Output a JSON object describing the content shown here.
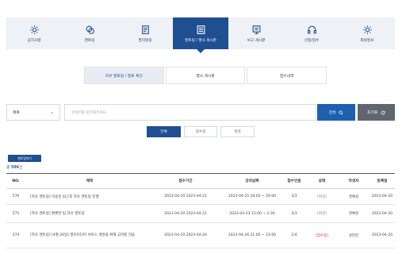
{
  "topnav": {
    "items": [
      {
        "label": "공지사항",
        "icon": "gear-icon",
        "active": false
      },
      {
        "label": "멘토링",
        "icon": "chat-icon",
        "active": false
      },
      {
        "label": "필리밍링",
        "icon": "document-icon",
        "active": false
      },
      {
        "label": "멘토링 / 행사 게시판",
        "icon": "board-icon",
        "active": true
      },
      {
        "label": "보고 게시판",
        "icon": "report-icon",
        "active": false
      },
      {
        "label": "신청/접수",
        "icon": "headset-icon",
        "active": false
      },
      {
        "label": "회원정보",
        "icon": "gear-icon",
        "active": false
      }
    ],
    "active_color": "#1e4f90"
  },
  "subtabs": [
    {
      "label": "자유 멘토링 / 멘토 특강",
      "active": true
    },
    {
      "label": "행사 게시판",
      "active": false
    },
    {
      "label": "접수내역",
      "active": false
    }
  ],
  "search": {
    "select_value": "제목",
    "placeholder": "검색어를 입력해주세요.",
    "search_label": "검색",
    "reset_label": "초기화"
  },
  "filters": [
    {
      "label": "전체",
      "active": true
    },
    {
      "label": "접수중",
      "active": false
    },
    {
      "label": "마감",
      "active": false
    }
  ],
  "list": {
    "open_button": "멘토링하기",
    "total_prefix": "총",
    "total_count": "596",
    "total_suffix": "건"
  },
  "table": {
    "headers": [
      "NO.",
      "제목",
      "접수기간",
      "강의날짜",
      "접수인원",
      "상태",
      "작성자",
      "등록일"
    ],
    "rows": [
      {
        "no": "576",
        "title": "[자유 멘토링] 이승민 퇴근후 자유 멘토링 진행",
        "period": "2023-04-20 2023-04-21",
        "date": "2023-04-25 18:00 ~ 20:00",
        "count": "3/3",
        "status": "[마감]",
        "status_type": "closed",
        "author": "권예성",
        "reg": "2023-04-20"
      },
      {
        "no": "575",
        "title": "[자유 멘토링] 편편한 팀 자유 멘토링",
        "period": "2023-04-20 2023-04-21",
        "date": "2023-04-23 13:00 ~ 2:30",
        "count": "3/3",
        "status": "[마감]",
        "status_type": "closed",
        "author": "권예성",
        "reg": "2023-04-20"
      },
      {
        "no": "574",
        "title": "[자유 멘토링] [4월 26일] 멀티미디어 서비스 개발을 위해 고려할 것들",
        "period": "2023-04-20 2023-04-26",
        "date": "2023-04-26 21:00 ~ 23:00",
        "count": "1/4",
        "status": "[접수중]",
        "status_type": "open",
        "author": "성현진",
        "reg": "2023-04-20"
      }
    ]
  }
}
